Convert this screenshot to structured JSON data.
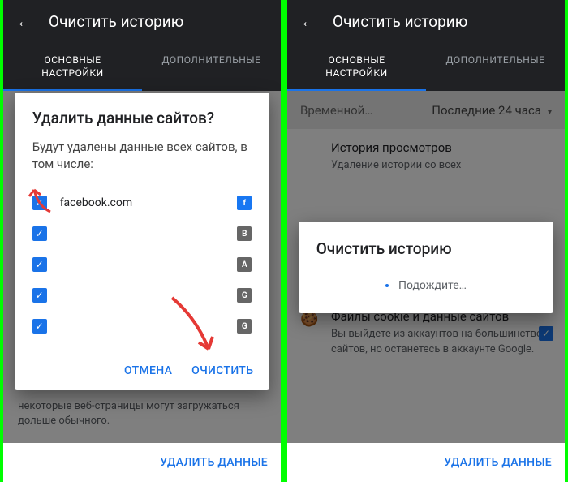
{
  "shared": {
    "title": "Очистить историю",
    "tab_basic": "ОСНОВНЫЕ\nНАСТРОЙКИ",
    "tab_adv": "ДОПОЛНИТЕЛЬНЫЕ",
    "footer": "УДАЛИТЬ ДАННЫЕ"
  },
  "left": {
    "dialog_title": "Удалить данные сайтов?",
    "dialog_desc": "Будут удалены данные всех сайтов, в том числе:",
    "sites": [
      {
        "name": "facebook.com",
        "badge": "f",
        "cls": "fb"
      },
      {
        "name": "",
        "badge": "B",
        "cls": "bg"
      },
      {
        "name": "",
        "badge": "A",
        "cls": "bg"
      },
      {
        "name": "",
        "badge": "G",
        "cls": "bg"
      },
      {
        "name": "",
        "badge": "G",
        "cls": "bg"
      }
    ],
    "cancel": "ОТМЕНА",
    "clear": "ОЧИСТИТЬ",
    "behind": "некоторые веб-страницы могут загружаться дольше обычного."
  },
  "right": {
    "range_label": "Временной…",
    "range_value": "Последние 24 часа",
    "section1_title": "История просмотров",
    "section1_desc": "Удаление истории со всех",
    "section2_title": "Файлы cookie и данные сайтов",
    "section2_desc": "Вы выйдете из аккаунтов на большинстве сайтов, но останетесь в аккаунте Google.",
    "dlg_title": "Очистить историю",
    "dlg_wait": "Подождите…"
  }
}
